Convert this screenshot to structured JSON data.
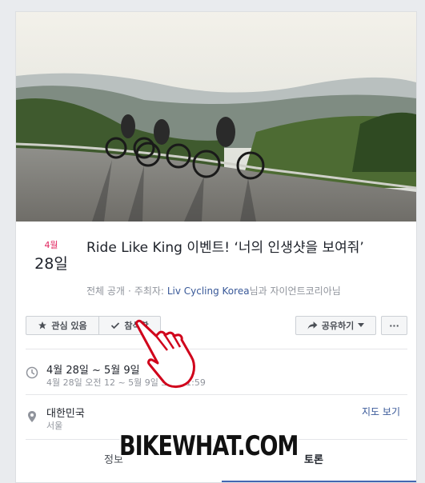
{
  "event": {
    "cover_alt": "Three cyclists riding along a hilltop road at sunset",
    "date": {
      "month": "4월",
      "day": "28일"
    },
    "title": "Ride Like King 이벤트! ‘너의 인생샷을 보여줘’",
    "meta": {
      "privacy": "전체 공개",
      "host_prefix": "주최자:",
      "host_name": "Liv Cycling Korea",
      "host_suffix": "님과 자이언트코리아님"
    }
  },
  "actions": {
    "interested_label": "관심 있음",
    "going_label": "참석함",
    "share_label": "공유하기",
    "more_label": "···"
  },
  "details": {
    "time_main": "4월 28일 ~ 5월 9일",
    "time_sub": "4월 28일 오전 12 ~ 5월 9일 오후 11:59",
    "location_main": "대한민국",
    "location_sub": "서울",
    "map_link": "지도 보기"
  },
  "tabs": [
    {
      "label": "정보",
      "active": false
    },
    {
      "label": "토론",
      "active": true
    }
  ],
  "watermark": "BIKEWHAT.COM",
  "colors": {
    "date_month": "#e0245e",
    "link": "#385898",
    "tab_active": "#4267b2",
    "hand_outline": "#d0021b"
  }
}
